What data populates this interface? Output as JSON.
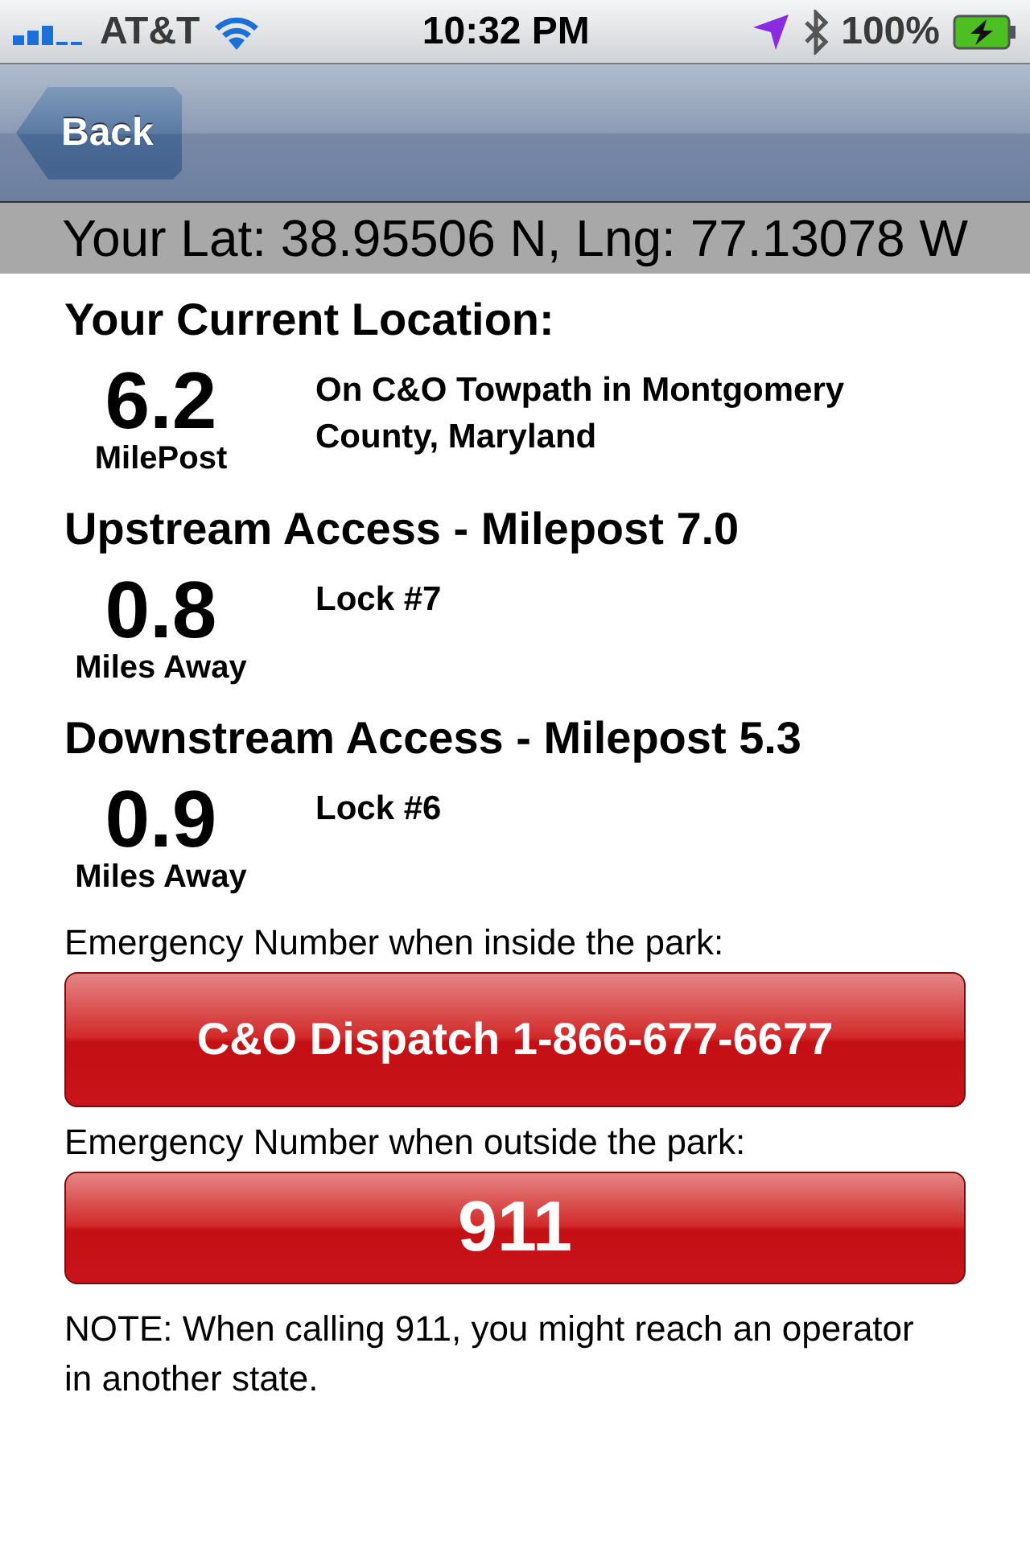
{
  "status_bar": {
    "carrier": "AT&T",
    "time": "10:32 PM",
    "battery": "100%"
  },
  "nav_bar": {
    "back_button": "Back"
  },
  "coordinates": "Your Lat: 38.95506 N, Lng: 77.13078 W",
  "sections": [
    {
      "heading": "Your Current Location:",
      "value": "6.2",
      "unit": "MilePost",
      "description": "On C&O Towpath in Montgomery County, Maryland"
    },
    {
      "heading": "Upstream Access - Milepost 7.0",
      "value": "0.8",
      "unit": "Miles Away",
      "description": "Lock #7"
    },
    {
      "heading": "Downstream Access - Milepost 5.3",
      "value": "0.9",
      "unit": "Miles Away",
      "description": "Lock #6"
    }
  ],
  "emergency": [
    {
      "label": "Emergency Number when inside the park:",
      "button": "C&O Dispatch 1-866-677-6677",
      "kind": "dispatch"
    },
    {
      "label": "Emergency Number when outside the park:",
      "button": "911",
      "kind": "call"
    }
  ],
  "note": "NOTE:  When calling 911, you might reach an operator in another state."
}
